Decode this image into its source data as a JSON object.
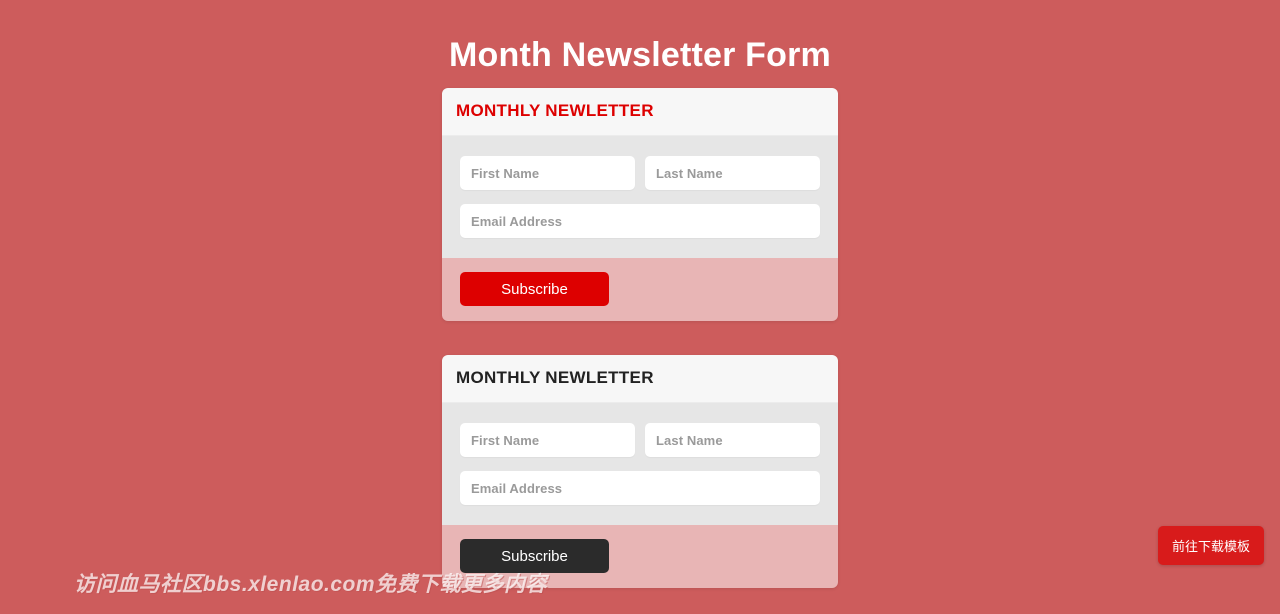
{
  "page": {
    "title": "Month Newsletter Form",
    "background_color": "#cd5c5c"
  },
  "colors": {
    "accent_red": "#dd0000",
    "accent_dark": "#222222",
    "card_header_bg": "#f7f7f7",
    "card_body_bg": "#e6e6e6",
    "download_btn_bg": "#d81b1b"
  },
  "cards": [
    {
      "header": "MONTHLY NEWLETTER",
      "header_style": "accent-red",
      "fields": {
        "first_name": {
          "placeholder": "First Name",
          "value": ""
        },
        "last_name": {
          "placeholder": "Last Name",
          "value": ""
        },
        "email": {
          "placeholder": "Email Address",
          "value": ""
        }
      },
      "submit_label": "Subscribe",
      "submit_style": "btn-red"
    },
    {
      "header": "MONTHLY NEWLETTER",
      "header_style": "accent-dark",
      "fields": {
        "first_name": {
          "placeholder": "First Name",
          "value": ""
        },
        "last_name": {
          "placeholder": "Last Name",
          "value": ""
        },
        "email": {
          "placeholder": "Email Address",
          "value": ""
        }
      },
      "submit_label": "Subscribe",
      "submit_style": "btn-dark"
    }
  ],
  "watermark": {
    "text": "访问血马社区bbs.xlenlao.com免费下载更多内容"
  },
  "download_button": {
    "label": "前往下载模板"
  }
}
